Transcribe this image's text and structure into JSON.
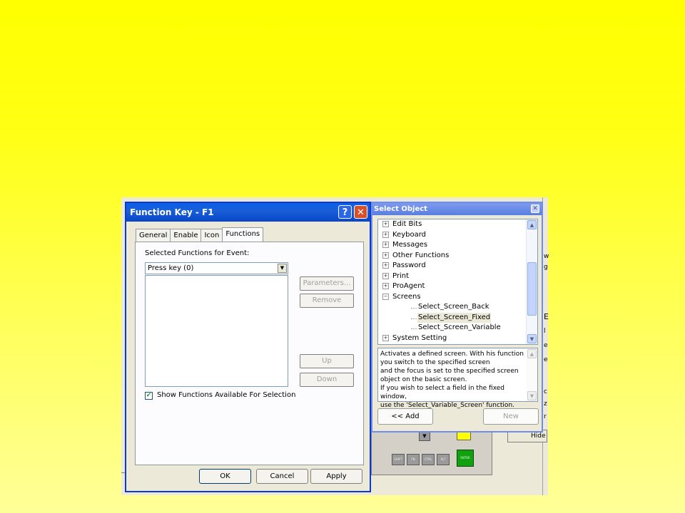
{
  "dialog": {
    "title": "Function Key - F1",
    "help_glyph": "?",
    "close_glyph": "✕",
    "tabs": [
      "General",
      "Enable",
      "Icon",
      "Functions"
    ],
    "active_tab": "Functions",
    "selected_functions_label": "Selected Functions for Event:",
    "event_combo_value": "Press key  (0)",
    "parameters_label": "Parameters...",
    "remove_label": "Remove",
    "up_label": "Up",
    "down_label": "Down",
    "show_functions_label": "Show Functions Available For Selection",
    "show_functions_checked": true,
    "ok_label": "OK",
    "cancel_label": "Cancel",
    "apply_label": "Apply"
  },
  "select_object": {
    "title": "Select Object",
    "close_glyph": "✕",
    "tree_items": [
      {
        "label": "Edit Bits",
        "type": "folder"
      },
      {
        "label": "Keyboard",
        "type": "folder"
      },
      {
        "label": "Messages",
        "type": "folder"
      },
      {
        "label": "Other Functions",
        "type": "folder"
      },
      {
        "label": "Password",
        "type": "folder"
      },
      {
        "label": "Print",
        "type": "folder"
      },
      {
        "label": "ProAgent",
        "type": "folder"
      },
      {
        "label": "Screens",
        "type": "folder-open"
      },
      {
        "label": "Select_Screen_Back",
        "type": "leaf"
      },
      {
        "label": "Select_Screen_Fixed",
        "type": "leaf-selected"
      },
      {
        "label": "Select_Screen_Variable",
        "type": "leaf"
      },
      {
        "label": "System Setting",
        "type": "folder"
      }
    ],
    "description_lines": [
      "Activates a defined screen. With his function",
      "you switch to the specified screen",
      "and the focus is set to the specified screen",
      "object on the basic screen.",
      "If you wish to select a field in the fixed window,",
      "use the 'Select_Variable_Screen' function."
    ],
    "add_label": "<< Add",
    "new_label": "New"
  },
  "background": {
    "hide_button_label": "Hide",
    "keypad_keys": [
      "SHIFT",
      "FN",
      "CTRL",
      "ALT"
    ],
    "enter_key_label": "ENTER",
    "down_key_glyph": "▼",
    "partial_labels": [
      "w",
      "g",
      "E",
      "l",
      "e",
      "e",
      "c",
      "z",
      "r"
    ]
  },
  "colors": {
    "page_background": "#ffff00",
    "titlebar": "#0a5fe8",
    "select_object_titlebar": "#6f8de6",
    "enter_key": "#10a010",
    "selected_tree_item": "#ece9d8"
  }
}
